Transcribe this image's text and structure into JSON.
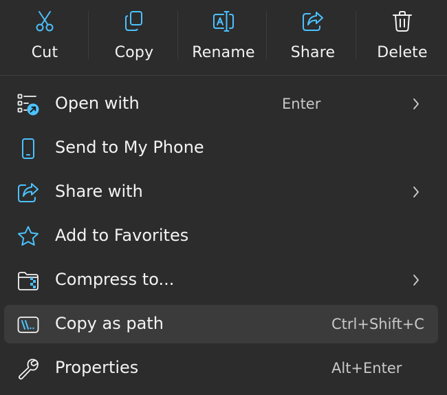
{
  "toolbar": {
    "items": [
      {
        "label": "Cut",
        "icon": "scissors-icon"
      },
      {
        "label": "Copy",
        "icon": "copy-icon"
      },
      {
        "label": "Rename",
        "icon": "rename-icon"
      },
      {
        "label": "Share",
        "icon": "share-icon"
      },
      {
        "label": "Delete",
        "icon": "trash-icon"
      }
    ]
  },
  "menu": {
    "items": [
      {
        "label": "Open with",
        "shortcut": "Enter",
        "has_submenu": true,
        "icon": "open-with-icon"
      },
      {
        "label": "Send to My Phone",
        "shortcut": "",
        "has_submenu": false,
        "icon": "phone-icon"
      },
      {
        "label": "Share with",
        "shortcut": "",
        "has_submenu": true,
        "icon": "share-with-icon"
      },
      {
        "label": "Add to Favorites",
        "shortcut": "",
        "has_submenu": false,
        "icon": "star-icon"
      },
      {
        "label": "Compress to...",
        "shortcut": "",
        "has_submenu": true,
        "icon": "zip-folder-icon"
      },
      {
        "label": "Copy as path",
        "shortcut": "Ctrl+Shift+C",
        "has_submenu": false,
        "icon": "copy-path-icon",
        "highlighted": true
      },
      {
        "label": "Properties",
        "shortcut": "Alt+Enter",
        "has_submenu": false,
        "icon": "wrench-icon"
      }
    ]
  },
  "colors": {
    "background": "#2c2c2c",
    "hover": "#3b3b3b",
    "accent": "#4cc2ff",
    "text": "#f3f3f3",
    "shortcut_text": "#c9c9c9"
  }
}
